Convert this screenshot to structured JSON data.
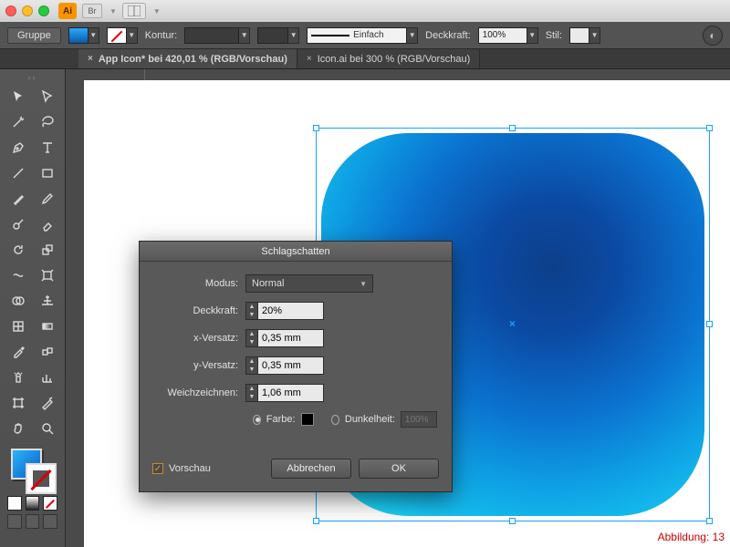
{
  "app": {
    "badge": "Ai",
    "bridge_badge": "Br"
  },
  "controlbar": {
    "group_label": "Gruppe",
    "contour_label": "Kontur:",
    "stroke_pt": "▾",
    "line_style_label": "Einfach",
    "opacity_label": "Deckkraft:",
    "opacity_value": "100%",
    "style_label": "Stil:"
  },
  "tabs": [
    {
      "label": "App Icon* bei 420,01 % (RGB/Vorschau)",
      "active": true
    },
    {
      "label": "Icon.ai bei 300 % (RGB/Vorschau)",
      "active": false
    }
  ],
  "dialog": {
    "title": "Schlagschatten",
    "mode_label": "Modus:",
    "mode_value": "Normal",
    "opacity_label": "Deckkraft:",
    "opacity_value": "20%",
    "x_label": "x-Versatz:",
    "x_value": "0,35 mm",
    "y_label": "y-Versatz:",
    "y_value": "0,35 mm",
    "blur_label": "Weichzeichnen:",
    "blur_value": "1,06 mm",
    "color_label": "Farbe:",
    "darkness_label": "Dunkelheit:",
    "darkness_value": "100%",
    "preview_label": "Vorschau",
    "cancel": "Abbrechen",
    "ok": "OK"
  },
  "figure_label": "Abbildung: 13"
}
